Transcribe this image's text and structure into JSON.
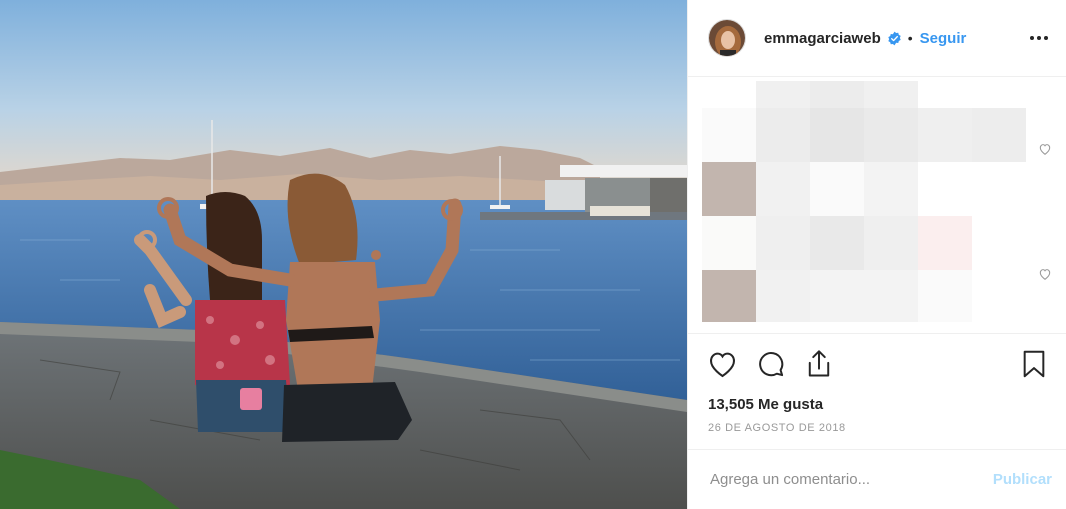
{
  "post": {
    "username": "emmagarciaweb",
    "separator": "•",
    "follow_label": "Seguir",
    "likes": "13,505 Me gusta",
    "date": "26 DE AGOSTO DE 2018"
  },
  "comment_box": {
    "placeholder": "Agrega un comentario...",
    "publish_label": "Publicar"
  },
  "colors": {
    "accent": "#3897f0",
    "publish_disabled": "#b2dffc",
    "verified": "#3897f0"
  },
  "icons": [
    "verified-badge-icon",
    "more-options-icon",
    "heart-icon",
    "comment-icon",
    "share-icon",
    "bookmark-icon"
  ]
}
